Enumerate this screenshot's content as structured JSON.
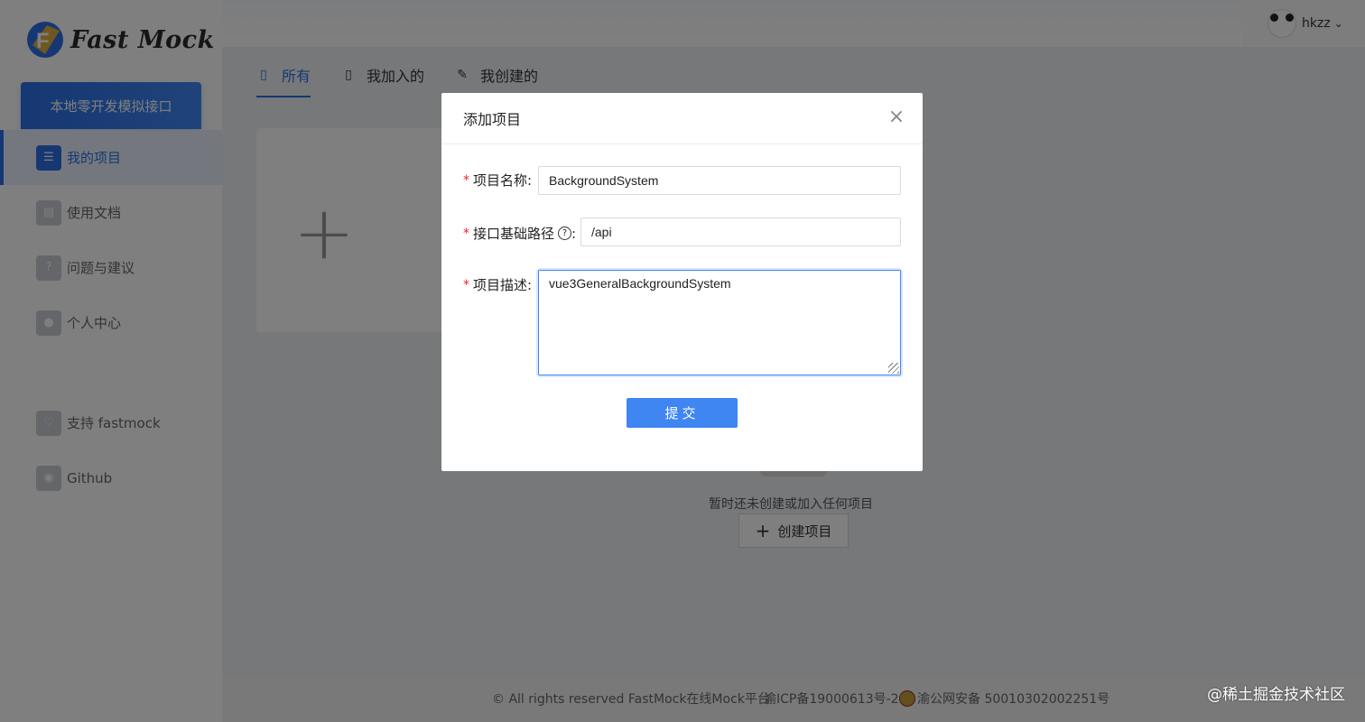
{
  "brand": {
    "name": "Fast Mock"
  },
  "sidebar": {
    "promo_label": "本地零开发模拟接口",
    "items": [
      {
        "label": "我的项目",
        "icon": "list-icon"
      },
      {
        "label": "使用文档",
        "icon": "document-icon"
      },
      {
        "label": "问题与建议",
        "icon": "question-icon"
      },
      {
        "label": "个人中心",
        "icon": "user-icon"
      },
      {
        "label": "支持 fastmock",
        "icon": "heart-icon"
      },
      {
        "label": "Github",
        "icon": "github-icon"
      }
    ]
  },
  "header": {
    "username": "hkzz",
    "dropdown_glyph": "⌄"
  },
  "tabs": [
    {
      "label": "所有"
    },
    {
      "label": "我加入的"
    },
    {
      "label": "我创建的"
    }
  ],
  "main": {
    "empty_text": "暂时还未创建或加入任何项目",
    "create_button": "创建项目"
  },
  "footer": {
    "copyright": "© All rights reserved FastMock在线Mock平台",
    "icp": "渝ICP备19000613号-2",
    "gongan": "渝公网安备 50010302002251号"
  },
  "watermark": "@稀土掘金技术社区",
  "modal": {
    "title": "添加项目",
    "close_glyph": "×",
    "fields": {
      "name": {
        "label": "项目名称:",
        "value": "BackgroundSystem"
      },
      "base_path": {
        "label": "接口基础路径",
        "help": "?",
        "colon": ":",
        "value": "/api"
      },
      "description": {
        "label": "项目描述:",
        "value": "vue3GeneralBackgroundSystem"
      }
    },
    "submit": "提交"
  },
  "colors": {
    "accent": "#3f86f3",
    "required": "#f5222d"
  }
}
